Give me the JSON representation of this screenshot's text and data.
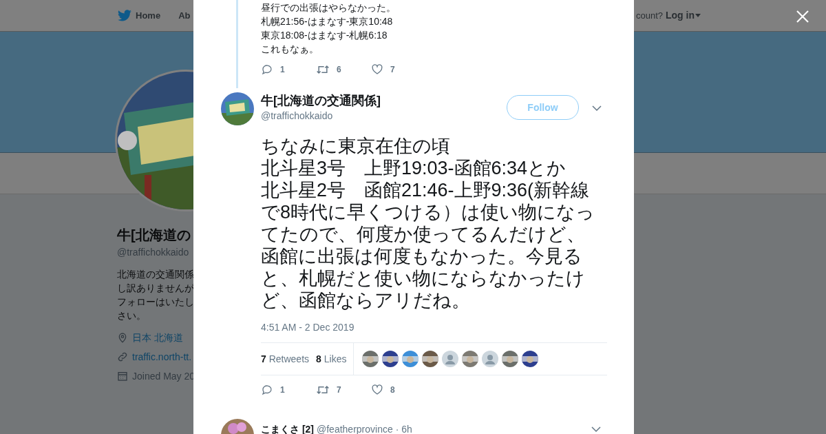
{
  "background": {
    "nav": {
      "home": "Home",
      "about": "Ab",
      "account_prompt": "count?",
      "login": "Log in"
    },
    "profile": {
      "name": "牛[北海道の",
      "handle": "@traffichokkaido",
      "bio_lines": [
        "北海道の交通関係",
        "し訳ありませんが",
        "フォローはいたし",
        "さい。"
      ],
      "location": "日本 北海道",
      "url": "traffic.north-tt.",
      "joined": "Joined May 20"
    }
  },
  "previous_tweet": {
    "lines": [
      "昼行での出張はやらなかった。",
      "札幌21:56-はまなす-東京10:48",
      "東京18:08-はまなす-札幌6:18",
      "これもなぁ。"
    ],
    "replies": "1",
    "retweets": "6",
    "likes": "7"
  },
  "tweet": {
    "name": "牛[北海道の交通関係]",
    "handle": "@traffichokkaido",
    "follow": "Follow",
    "text_lines": [
      "ちなみに東京在住の頃",
      "北斗星3号　上野19:03-函館6:34とか",
      "北斗星2号　函館21:46-上野9:36(新幹線で8時代に早くつける）は使い物になってたので、何度か使ってるんだけど、函館に出張は何度もなかった。今見ると、札幌だと使い物にならなかったけど、函館ならアリだね。"
    ],
    "time": "4:51 AM - 2 Dec 2019",
    "retweet_count": "7",
    "retweet_label": "Retweets",
    "like_count": "8",
    "like_label": "Likes",
    "likers": [
      {
        "kind": "picture"
      },
      {
        "kind": "picture"
      },
      {
        "kind": "picture"
      },
      {
        "kind": "picture"
      },
      {
        "kind": "default"
      },
      {
        "kind": "picture"
      },
      {
        "kind": "default"
      },
      {
        "kind": "picture"
      },
      {
        "kind": "picture"
      }
    ],
    "replies": "1",
    "retweets": "7",
    "likes": "8"
  },
  "next_tweet": {
    "name": "こまくさ [2]",
    "handle": "@featherprovince",
    "time": "· 6h"
  }
}
